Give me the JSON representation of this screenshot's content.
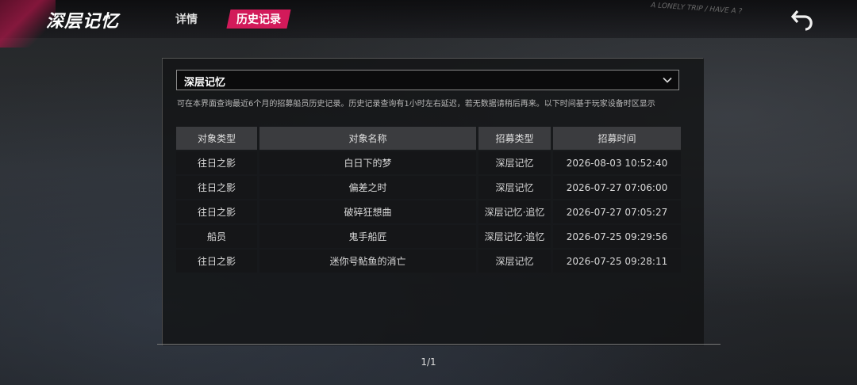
{
  "header": {
    "app_title": "深层记忆",
    "tabs": [
      {
        "label": "详情",
        "active": false
      },
      {
        "label": "历史记录",
        "active": true
      }
    ],
    "deco_text": "A LONELY TRIP / HAVE A ?",
    "back_icon": "back-arrow-icon"
  },
  "filter": {
    "selected": "深层记忆",
    "icon": "chevron-down-icon"
  },
  "notice": "可在本界面查询最近6个月的招募船员历史记录。历史记录查询有1小时左右延迟，若无数据请稍后再来。以下时间基于玩家设备时区显示",
  "table": {
    "headers": [
      "对象类型",
      "对象名称",
      "招募类型",
      "招募时间"
    ],
    "rows": [
      {
        "type": "往日之影",
        "name": "白日下的梦",
        "recruit": "深层记忆",
        "time": "2026-08-03 10:52:40",
        "name_color": "#c15cf0"
      },
      {
        "type": "往日之影",
        "name": "偏差之时",
        "recruit": "深层记忆",
        "time": "2026-07-27 07:06:00",
        "name_color": "#c15cf0"
      },
      {
        "type": "往日之影",
        "name": "破碎狂想曲",
        "recruit": "深层记忆·追忆",
        "time": "2026-07-27 07:05:27",
        "name_color": "#f2a04c"
      },
      {
        "type": "船员",
        "name": "鬼手船匠",
        "recruit": "深层记忆·追忆",
        "time": "2026-07-25 09:29:56",
        "name_color": "#e44fd0"
      },
      {
        "type": "往日之影",
        "name": "迷你号鲇鱼的消亡",
        "recruit": "深层记忆",
        "time": "2026-07-25 09:28:11",
        "name_color": "#c15cf0"
      }
    ]
  },
  "pagination": "1/1",
  "colors": {
    "accent": "#d21a5a",
    "rarity_purple": "#c15cf0",
    "rarity_orange": "#f2a04c",
    "rarity_pink": "#e44fd0"
  }
}
